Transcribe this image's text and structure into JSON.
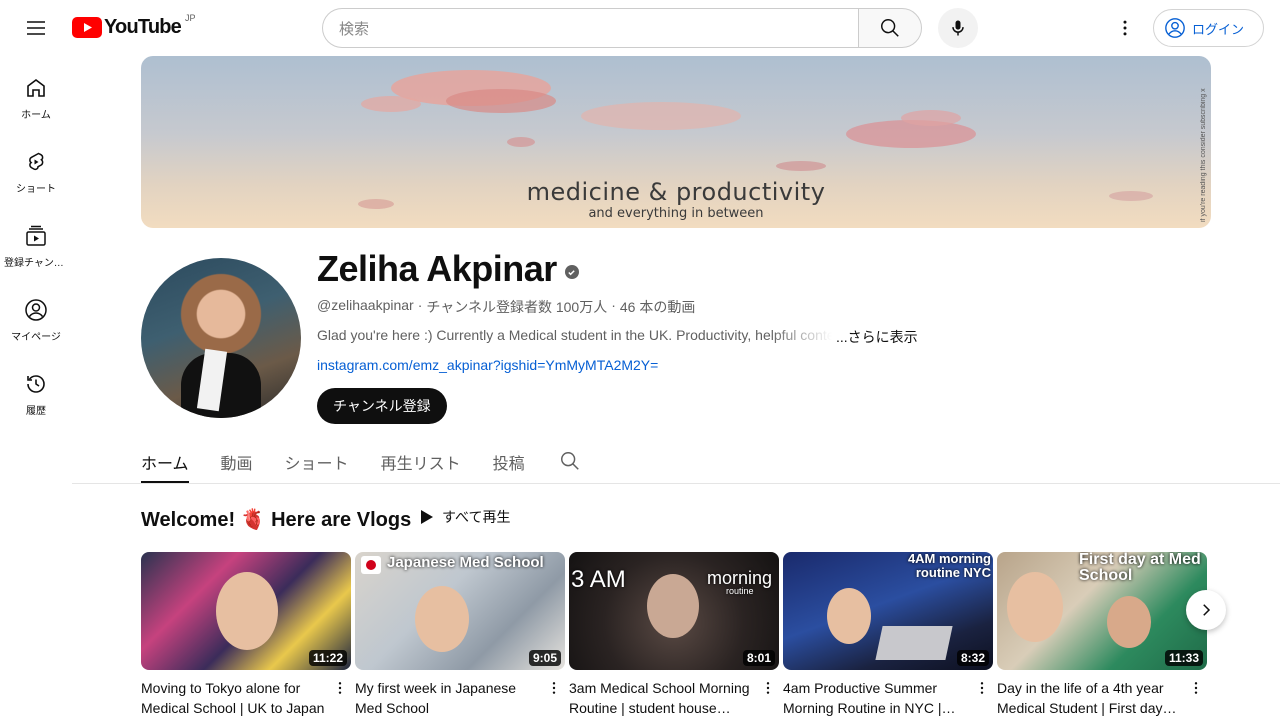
{
  "header": {
    "logo_text": "YouTube",
    "logo_region": "JP",
    "search_placeholder": "検索",
    "login_label": "ログイン"
  },
  "sidebar": {
    "items": [
      {
        "label": "ホーム",
        "icon": "home-icon"
      },
      {
        "label": "ショート",
        "icon": "shorts-icon"
      },
      {
        "label": "登録チャンネル",
        "icon": "subscriptions-icon"
      },
      {
        "label": "マイページ",
        "icon": "account-icon"
      },
      {
        "label": "履歴",
        "icon": "history-icon"
      }
    ]
  },
  "banner": {
    "title": "medicine & productivity",
    "subtitle": "and everything in between",
    "side_note": "if you're reading this consider subscribing x"
  },
  "channel": {
    "name": "Zeliha Akpinar",
    "handle": "@zelihaakpinar",
    "subscribers": "チャンネル登録者数 100万人",
    "videos_count": "46 本の動画",
    "description": "Glad you're here :) Currently a Medical student in the UK. Productivity, helpful content",
    "show_more": "...さらに表示",
    "link": "instagram.com/emz_akpinar?igshid=YmMyMTA2M2Y=",
    "subscribe_label": "チャンネル登録"
  },
  "tabs": [
    {
      "label": "ホーム",
      "active": true
    },
    {
      "label": "動画",
      "active": false
    },
    {
      "label": "ショート",
      "active": false
    },
    {
      "label": "再生リスト",
      "active": false
    },
    {
      "label": "投稿",
      "active": false
    }
  ],
  "shelf": {
    "title": "Welcome! 🫀 Here are Vlogs",
    "play_all_label": "すべて再生"
  },
  "videos": [
    {
      "title": "Moving to Tokyo alone for Medical School | UK to Japan",
      "duration": "11:22",
      "thumb_text": ""
    },
    {
      "title": "My first week in Japanese Med School",
      "duration": "9:05",
      "thumb_text": "Japanese Med School"
    },
    {
      "title": "3am Medical School Morning Routine | student house…",
      "duration": "8:01",
      "thumb_text": "3 AM"
    },
    {
      "title": "4am Productive Summer Morning Routine in NYC |…",
      "duration": "8:32",
      "thumb_text": "4AM morning routine NYC"
    },
    {
      "title": "Day in the life of a 4th year Medical Student | First day…",
      "duration": "11:33",
      "thumb_text": "First day at Med School"
    }
  ],
  "thumb_extras": {
    "video3_word": "morning",
    "video3_sub": "routine"
  }
}
